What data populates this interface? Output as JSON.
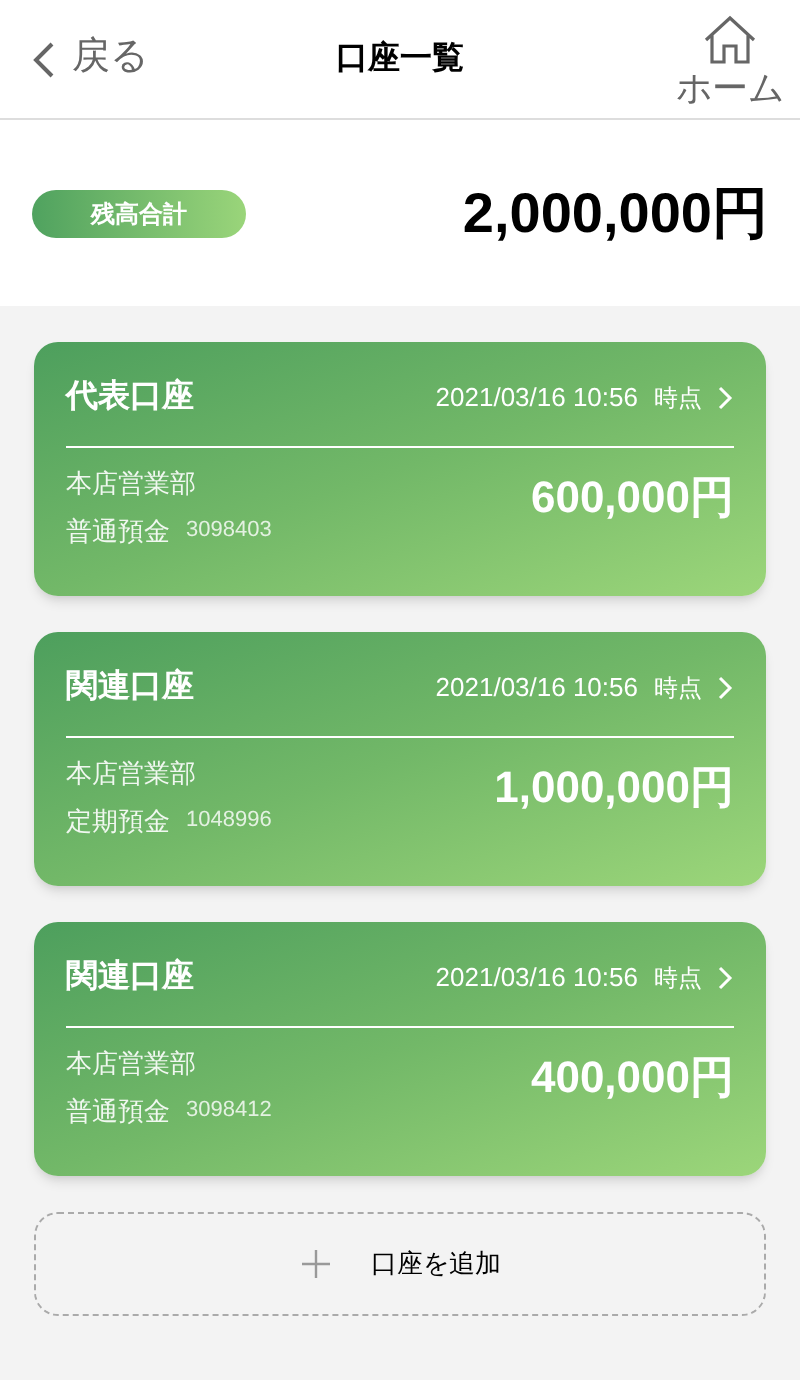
{
  "header": {
    "back": "戻る",
    "title": "口座一覧",
    "home": "ホーム"
  },
  "total": {
    "label": "残高合計",
    "amount": "2,000,000円"
  },
  "accounts": [
    {
      "name": "代表口座",
      "timestamp": "2021/03/16 10:56",
      "time_suffix": "時点",
      "branch": "本店営業部",
      "type": "普通預金",
      "number": "3098403",
      "amount": "600,000円"
    },
    {
      "name": "関連口座",
      "timestamp": "2021/03/16 10:56",
      "time_suffix": "時点",
      "branch": "本店営業部",
      "type": "定期預金",
      "number": "1048996",
      "amount": "1,000,000円"
    },
    {
      "name": "関連口座",
      "timestamp": "2021/03/16 10:56",
      "time_suffix": "時点",
      "branch": "本店営業部",
      "type": "普通預金",
      "number": "3098412",
      "amount": "400,000円"
    }
  ],
  "add_button": "口座を追加"
}
